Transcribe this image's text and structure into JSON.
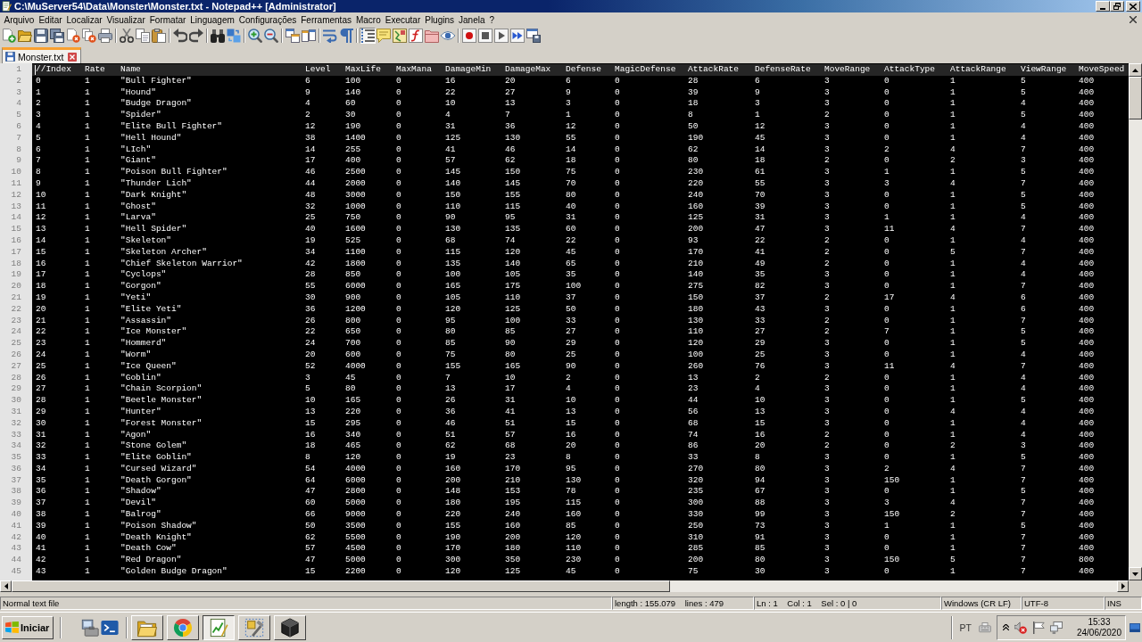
{
  "window": {
    "title": "C:\\MuServer54\\Data\\Monster\\Monster.txt - Notepad++ [Administrator]"
  },
  "menu": [
    "Arquivo",
    "Editar",
    "Localizar",
    "Visualizar",
    "Formatar",
    "Linguagem",
    "Configurações",
    "Ferramentas",
    "Macro",
    "Executar",
    "Plugins",
    "Janela",
    "?"
  ],
  "toolbar": [
    {
      "pressed": false
    },
    {
      "pressed": false
    },
    {
      "pressed": false
    },
    {
      "pressed": false
    },
    {
      "pressed": false
    },
    {
      "pressed": false
    },
    {
      "pressed": false
    },
    {
      "pressed": false
    },
    {
      "pressed": false
    },
    {
      "pressed": false
    },
    {
      "pressed": false
    },
    {
      "pressed": false
    },
    {
      "pressed": false
    },
    {
      "pressed": false
    },
    {
      "pressed": false
    },
    {
      "pressed": false
    },
    {
      "pressed": false
    },
    {
      "pressed": false
    },
    {
      "pressed": false
    },
    {
      "pressed": false
    },
    {
      "pressed": true
    },
    {
      "pressed": false
    },
    {
      "pressed": false
    },
    {
      "pressed": false
    },
    {
      "pressed": false
    },
    {
      "pressed": false
    },
    {
      "pressed": false
    },
    {
      "pressed": false
    },
    {
      "pressed": false
    },
    {
      "pressed": false
    },
    {
      "pressed": false
    }
  ],
  "tabs": [
    {
      "label": "Monster.txt",
      "selected": true
    }
  ],
  "editor": {
    "lines": [
      {
        "number": "1",
        "current": true,
        "cells": [
          "//Index",
          "Rate",
          "Name",
          "Level",
          "MaxLife",
          "MaxMana",
          "DamageMin",
          "DamageMax",
          "Defense",
          "MagicDefense",
          "AttackRate",
          "DefenseRate",
          "MoveRange",
          "AttackType",
          "AttackRange",
          "ViewRange",
          "MoveSpeed"
        ]
      },
      {
        "number": "2",
        "current": false,
        "cells": [
          "0",
          "1",
          "\"Bull Fighter\"",
          "6",
          "100",
          "0",
          "16",
          "20",
          "6",
          "0",
          "28",
          "6",
          "3",
          "0",
          "1",
          "5",
          "400"
        ]
      },
      {
        "number": "3",
        "current": false,
        "cells": [
          "1",
          "1",
          "\"Hound\"",
          "9",
          "140",
          "0",
          "22",
          "27",
          "9",
          "0",
          "39",
          "9",
          "3",
          "0",
          "1",
          "5",
          "400"
        ]
      },
      {
        "number": "4",
        "current": false,
        "cells": [
          "2",
          "1",
          "\"Budge Dragon\"",
          "4",
          "60",
          "0",
          "10",
          "13",
          "3",
          "0",
          "18",
          "3",
          "3",
          "0",
          "1",
          "4",
          "400"
        ]
      },
      {
        "number": "5",
        "current": false,
        "cells": [
          "3",
          "1",
          "\"Spider\"",
          "2",
          "30",
          "0",
          "4",
          "7",
          "1",
          "0",
          "8",
          "1",
          "2",
          "0",
          "1",
          "5",
          "400"
        ]
      },
      {
        "number": "6",
        "current": false,
        "cells": [
          "4",
          "1",
          "\"Elite Bull Fighter\"",
          "12",
          "190",
          "0",
          "31",
          "36",
          "12",
          "0",
          "50",
          "12",
          "3",
          "0",
          "1",
          "4",
          "400"
        ]
      },
      {
        "number": "7",
        "current": false,
        "cells": [
          "5",
          "1",
          "\"Hell Hound\"",
          "38",
          "1400",
          "0",
          "125",
          "130",
          "55",
          "0",
          "190",
          "45",
          "3",
          "0",
          "1",
          "4",
          "400"
        ]
      },
      {
        "number": "8",
        "current": false,
        "cells": [
          "6",
          "1",
          "\"LIch\"",
          "14",
          "255",
          "0",
          "41",
          "46",
          "14",
          "0",
          "62",
          "14",
          "3",
          "2",
          "4",
          "7",
          "400"
        ]
      },
      {
        "number": "9",
        "current": false,
        "cells": [
          "7",
          "1",
          "\"Giant\"",
          "17",
          "400",
          "0",
          "57",
          "62",
          "18",
          "0",
          "80",
          "18",
          "2",
          "0",
          "2",
          "3",
          "400"
        ]
      },
      {
        "number": "10",
        "current": false,
        "cells": [
          "8",
          "1",
          "\"Poison Bull Fighter\"",
          "46",
          "2500",
          "0",
          "145",
          "150",
          "75",
          "0",
          "230",
          "61",
          "3",
          "1",
          "1",
          "5",
          "400"
        ]
      },
      {
        "number": "11",
        "current": false,
        "cells": [
          "9",
          "1",
          "\"Thunder Lich\"",
          "44",
          "2000",
          "0",
          "140",
          "145",
          "70",
          "0",
          "220",
          "55",
          "3",
          "3",
          "4",
          "7",
          "400"
        ]
      },
      {
        "number": "12",
        "current": false,
        "cells": [
          "10",
          "1",
          "\"Dark Knight\"",
          "48",
          "3000",
          "0",
          "150",
          "155",
          "80",
          "0",
          "240",
          "70",
          "3",
          "0",
          "1",
          "5",
          "400"
        ]
      },
      {
        "number": "13",
        "current": false,
        "cells": [
          "11",
          "1",
          "\"Ghost\"",
          "32",
          "1000",
          "0",
          "110",
          "115",
          "40",
          "0",
          "160",
          "39",
          "3",
          "0",
          "1",
          "5",
          "400"
        ]
      },
      {
        "number": "14",
        "current": false,
        "cells": [
          "12",
          "1",
          "\"Larva\"",
          "25",
          "750",
          "0",
          "90",
          "95",
          "31",
          "0",
          "125",
          "31",
          "3",
          "1",
          "1",
          "4",
          "400"
        ]
      },
      {
        "number": "15",
        "current": false,
        "cells": [
          "13",
          "1",
          "\"Hell Spider\"",
          "40",
          "1600",
          "0",
          "130",
          "135",
          "60",
          "0",
          "200",
          "47",
          "3",
          "11",
          "4",
          "7",
          "400"
        ]
      },
      {
        "number": "16",
        "current": false,
        "cells": [
          "14",
          "1",
          "\"Skeleton\"",
          "19",
          "525",
          "0",
          "68",
          "74",
          "22",
          "0",
          "93",
          "22",
          "2",
          "0",
          "1",
          "4",
          "400"
        ]
      },
      {
        "number": "17",
        "current": false,
        "cells": [
          "15",
          "1",
          "\"Skeleton Archer\"",
          "34",
          "1100",
          "0",
          "115",
          "120",
          "45",
          "0",
          "170",
          "41",
          "2",
          "0",
          "5",
          "7",
          "400"
        ]
      },
      {
        "number": "18",
        "current": false,
        "cells": [
          "16",
          "1",
          "\"Chief Skeleton Warrior\"",
          "42",
          "1800",
          "0",
          "135",
          "140",
          "65",
          "0",
          "210",
          "49",
          "2",
          "0",
          "1",
          "4",
          "400"
        ]
      },
      {
        "number": "19",
        "current": false,
        "cells": [
          "17",
          "1",
          "\"Cyclops\"",
          "28",
          "850",
          "0",
          "100",
          "105",
          "35",
          "0",
          "140",
          "35",
          "3",
          "0",
          "1",
          "4",
          "400"
        ]
      },
      {
        "number": "20",
        "current": false,
        "cells": [
          "18",
          "1",
          "\"Gorgon\"",
          "55",
          "6000",
          "0",
          "165",
          "175",
          "100",
          "0",
          "275",
          "82",
          "3",
          "0",
          "1",
          "7",
          "400"
        ]
      },
      {
        "number": "21",
        "current": false,
        "cells": [
          "19",
          "1",
          "\"Yeti\"",
          "30",
          "900",
          "0",
          "105",
          "110",
          "37",
          "0",
          "150",
          "37",
          "2",
          "17",
          "4",
          "6",
          "400"
        ]
      },
      {
        "number": "22",
        "current": false,
        "cells": [
          "20",
          "1",
          "\"Elite Yeti\"",
          "36",
          "1200",
          "0",
          "120",
          "125",
          "50",
          "0",
          "180",
          "43",
          "3",
          "0",
          "1",
          "6",
          "400"
        ]
      },
      {
        "number": "23",
        "current": false,
        "cells": [
          "21",
          "1",
          "\"Assassin\"",
          "26",
          "800",
          "0",
          "95",
          "100",
          "33",
          "0",
          "130",
          "33",
          "2",
          "0",
          "1",
          "7",
          "400"
        ]
      },
      {
        "number": "24",
        "current": false,
        "cells": [
          "22",
          "1",
          "\"Ice Monster\"",
          "22",
          "650",
          "0",
          "80",
          "85",
          "27",
          "0",
          "110",
          "27",
          "2",
          "7",
          "1",
          "5",
          "400"
        ]
      },
      {
        "number": "25",
        "current": false,
        "cells": [
          "23",
          "1",
          "\"Hommerd\"",
          "24",
          "700",
          "0",
          "85",
          "90",
          "29",
          "0",
          "120",
          "29",
          "3",
          "0",
          "1",
          "5",
          "400"
        ]
      },
      {
        "number": "26",
        "current": false,
        "cells": [
          "24",
          "1",
          "\"Worm\"",
          "20",
          "600",
          "0",
          "75",
          "80",
          "25",
          "0",
          "100",
          "25",
          "3",
          "0",
          "1",
          "4",
          "400"
        ]
      },
      {
        "number": "27",
        "current": false,
        "cells": [
          "25",
          "1",
          "\"Ice Queen\"",
          "52",
          "4000",
          "0",
          "155",
          "165",
          "90",
          "0",
          "260",
          "76",
          "3",
          "11",
          "4",
          "7",
          "400"
        ]
      },
      {
        "number": "28",
        "current": false,
        "cells": [
          "26",
          "1",
          "\"Goblin\"",
          "3",
          "45",
          "0",
          "7",
          "10",
          "2",
          "0",
          "13",
          "2",
          "2",
          "0",
          "1",
          "4",
          "400"
        ]
      },
      {
        "number": "29",
        "current": false,
        "cells": [
          "27",
          "1",
          "\"Chain Scorpion\"",
          "5",
          "80",
          "0",
          "13",
          "17",
          "4",
          "0",
          "23",
          "4",
          "3",
          "0",
          "1",
          "4",
          "400"
        ]
      },
      {
        "number": "30",
        "current": false,
        "cells": [
          "28",
          "1",
          "\"Beetle Monster\"",
          "10",
          "165",
          "0",
          "26",
          "31",
          "10",
          "0",
          "44",
          "10",
          "3",
          "0",
          "1",
          "5",
          "400"
        ]
      },
      {
        "number": "31",
        "current": false,
        "cells": [
          "29",
          "1",
          "\"Hunter\"",
          "13",
          "220",
          "0",
          "36",
          "41",
          "13",
          "0",
          "56",
          "13",
          "3",
          "0",
          "4",
          "4",
          "400"
        ]
      },
      {
        "number": "32",
        "current": false,
        "cells": [
          "30",
          "1",
          "\"Forest Monster\"",
          "15",
          "295",
          "0",
          "46",
          "51",
          "15",
          "0",
          "68",
          "15",
          "3",
          "0",
          "1",
          "4",
          "400"
        ]
      },
      {
        "number": "33",
        "current": false,
        "cells": [
          "31",
          "1",
          "\"Agon\"",
          "16",
          "340",
          "0",
          "51",
          "57",
          "16",
          "0",
          "74",
          "16",
          "2",
          "0",
          "1",
          "4",
          "400"
        ]
      },
      {
        "number": "34",
        "current": false,
        "cells": [
          "32",
          "1",
          "\"Stone Golem\"",
          "18",
          "465",
          "0",
          "62",
          "68",
          "20",
          "0",
          "86",
          "20",
          "2",
          "0",
          "2",
          "3",
          "400"
        ]
      },
      {
        "number": "35",
        "current": false,
        "cells": [
          "33",
          "1",
          "\"Elite Goblin\"",
          "8",
          "120",
          "0",
          "19",
          "23",
          "8",
          "0",
          "33",
          "8",
          "3",
          "0",
          "1",
          "5",
          "400"
        ]
      },
      {
        "number": "36",
        "current": false,
        "cells": [
          "34",
          "1",
          "\"Cursed Wizard\"",
          "54",
          "4000",
          "0",
          "160",
          "170",
          "95",
          "0",
          "270",
          "80",
          "3",
          "2",
          "4",
          "7",
          "400"
        ]
      },
      {
        "number": "37",
        "current": false,
        "cells": [
          "35",
          "1",
          "\"Death Gorgon\"",
          "64",
          "6000",
          "0",
          "200",
          "210",
          "130",
          "0",
          "320",
          "94",
          "3",
          "150",
          "1",
          "7",
          "400"
        ]
      },
      {
        "number": "38",
        "current": false,
        "cells": [
          "36",
          "1",
          "\"Shadow\"",
          "47",
          "2800",
          "0",
          "148",
          "153",
          "78",
          "0",
          "235",
          "67",
          "3",
          "0",
          "1",
          "5",
          "400"
        ]
      },
      {
        "number": "39",
        "current": false,
        "cells": [
          "37",
          "1",
          "\"Devil\"",
          "60",
          "5000",
          "0",
          "180",
          "195",
          "115",
          "0",
          "300",
          "88",
          "3",
          "3",
          "4",
          "7",
          "400"
        ]
      },
      {
        "number": "40",
        "current": false,
        "cells": [
          "38",
          "1",
          "\"Balrog\"",
          "66",
          "9000",
          "0",
          "220",
          "240",
          "160",
          "0",
          "330",
          "99",
          "3",
          "150",
          "2",
          "7",
          "400"
        ]
      },
      {
        "number": "41",
        "current": false,
        "cells": [
          "39",
          "1",
          "\"Poison Shadow\"",
          "50",
          "3500",
          "0",
          "155",
          "160",
          "85",
          "0",
          "250",
          "73",
          "3",
          "1",
          "1",
          "5",
          "400"
        ]
      },
      {
        "number": "42",
        "current": false,
        "cells": [
          "40",
          "1",
          "\"Death Knight\"",
          "62",
          "5500",
          "0",
          "190",
          "200",
          "120",
          "0",
          "310",
          "91",
          "3",
          "0",
          "1",
          "7",
          "400"
        ]
      },
      {
        "number": "43",
        "current": false,
        "cells": [
          "41",
          "1",
          "\"Death Cow\"",
          "57",
          "4500",
          "0",
          "170",
          "180",
          "110",
          "0",
          "285",
          "85",
          "3",
          "0",
          "1",
          "7",
          "400"
        ]
      },
      {
        "number": "44",
        "current": false,
        "cells": [
          "42",
          "1",
          "\"Red Dragon\"",
          "47",
          "5000",
          "0",
          "300",
          "350",
          "230",
          "0",
          "200",
          "80",
          "3",
          "150",
          "5",
          "7",
          "800"
        ]
      },
      {
        "number": "45",
        "current": false,
        "cells": [
          "43",
          "1",
          "\"Golden Budge Dragon\"",
          "15",
          "2200",
          "0",
          "120",
          "125",
          "45",
          "0",
          "75",
          "30",
          "3",
          "0",
          "1",
          "7",
          "400"
        ]
      }
    ]
  },
  "status_bar": [
    "Normal text file",
    "length : 155.079    lines : 479",
    "Ln : 1    Col : 1    Sel : 0 | 0",
    "Windows (CR LF)",
    "UTF-8",
    "INS"
  ],
  "taskbar": {
    "start": "Iniciar",
    "apps": [
      {
        "selected": false
      },
      {
        "selected": false
      },
      {
        "selected": true
      },
      {
        "selected": false
      },
      {
        "selected": false
      }
    ],
    "language": "PT",
    "time": "15:33",
    "date": "24/06/2020"
  }
}
